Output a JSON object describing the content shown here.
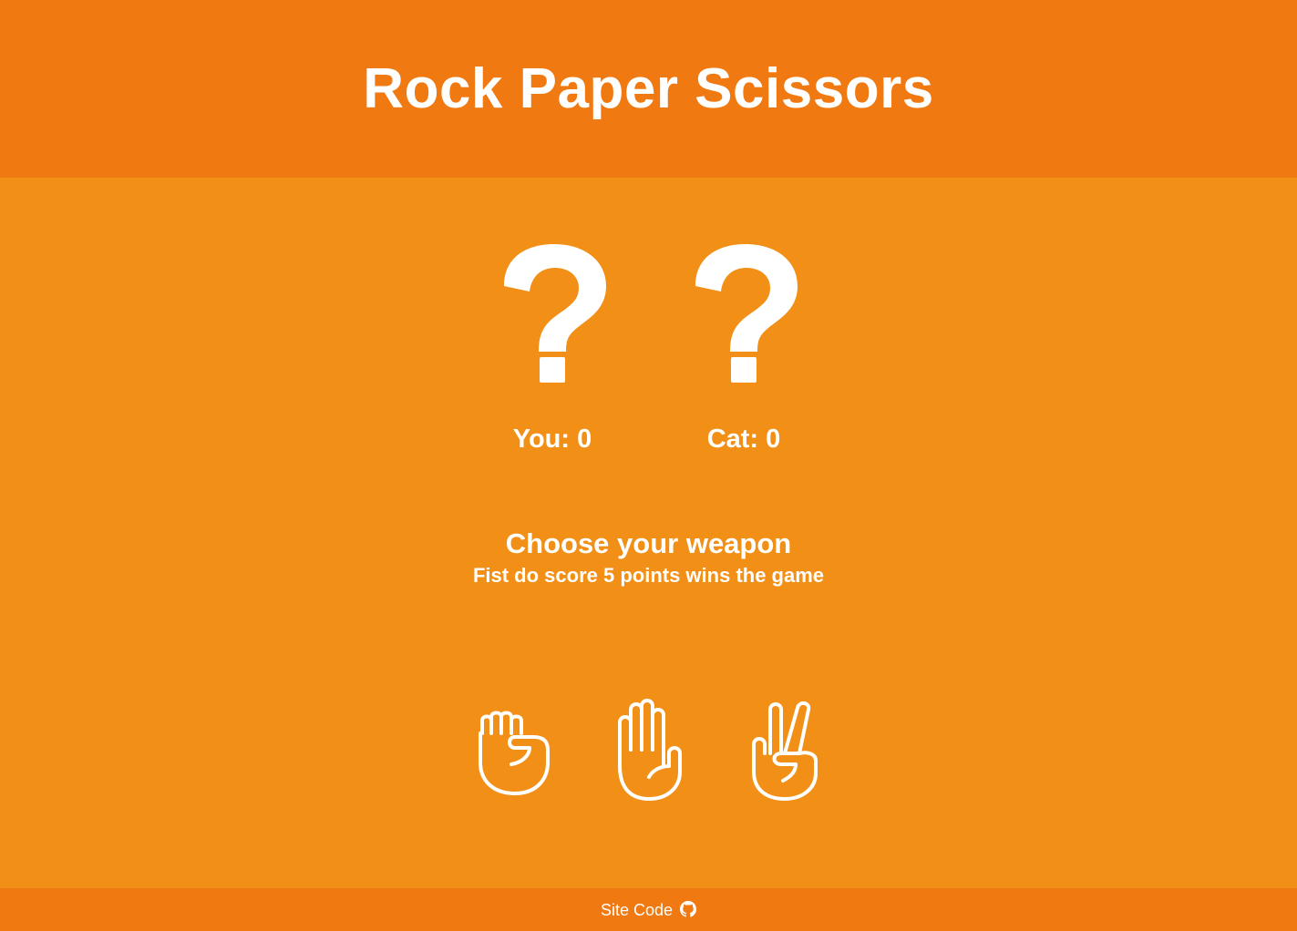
{
  "header": {
    "title": "Rock Paper Scissors"
  },
  "players": [
    {
      "label": "You: 0",
      "choice_icon": "question-mark-icon"
    },
    {
      "label": "Cat: 0",
      "choice_icon": "question-mark-icon"
    }
  ],
  "prompt": {
    "heading": "Choose your weapon",
    "subheading": "Fist do score 5 points wins the game"
  },
  "weapons": [
    {
      "name": "rock",
      "icon": "fist-icon"
    },
    {
      "name": "paper",
      "icon": "open-hand-icon"
    },
    {
      "name": "scissors",
      "icon": "victory-hand-icon"
    }
  ],
  "footer": {
    "link_label": "Site Code",
    "icon": "github-icon"
  },
  "colors": {
    "header_bg": "#f07912",
    "main_bg": "#f28f16",
    "footer_bg": "#f07912",
    "text": "#ffffff"
  }
}
